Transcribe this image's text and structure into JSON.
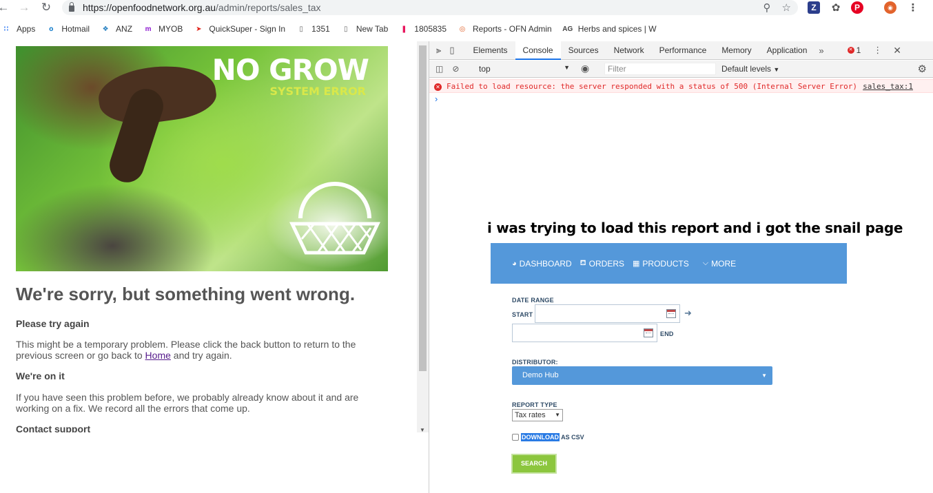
{
  "browser": {
    "url_host": "https://openfoodnetwork.org.au",
    "url_path": "/admin/reports/sales_tax",
    "back_icon": "arrow-left-icon",
    "forward_icon": "arrow-right-icon",
    "reload_icon": "reload-icon"
  },
  "bookmarks": [
    {
      "label": "Apps",
      "icon": "apps-grid-icon",
      "color": "#4285f4"
    },
    {
      "label": "Hotmail",
      "icon": "outlook-icon",
      "color": "#0072c6"
    },
    {
      "label": "ANZ",
      "icon": "anz-icon",
      "color": "#1e7bbf"
    },
    {
      "label": "MYOB",
      "icon": "myob-icon",
      "color": "#8f1cd1"
    },
    {
      "label": "QuickSuper - Sign In",
      "icon": "quicksuper-icon",
      "color": "#e2231a"
    },
    {
      "label": "1351",
      "icon": "page-icon",
      "color": "#666666"
    },
    {
      "label": "New Tab",
      "icon": "page-icon",
      "color": "#666666"
    },
    {
      "label": "1805835",
      "icon": "flag-icon",
      "color": "#e8145c"
    },
    {
      "label": "Reports - OFN Admin",
      "icon": "ofn-icon",
      "color": "#e2632c"
    },
    {
      "label": "Herbs and spices | W",
      "icon": "ag-icon",
      "color": "#444444"
    }
  ],
  "error_page": {
    "hero_title": "NO GROW",
    "hero_subtitle": "SYSTEM ERROR",
    "heading": "We're sorry, but something went wrong.",
    "try_again_title": "Please try again",
    "try_again_text_1": "This might be a temporary problem. Please click the back button to return to the previous screen or go back to ",
    "home_link": "Home",
    "try_again_text_2": " and try again.",
    "on_it_title": "We're on it",
    "on_it_text": "If you have seen this problem before, we probably already know about it and are working on a fix. We record all the errors that come up.",
    "contact_title": "Contact support"
  },
  "devtools": {
    "tabs": [
      "Elements",
      "Console",
      "Sources",
      "Network",
      "Performance",
      "Memory",
      "Application"
    ],
    "active_tab": "Console",
    "error_count": "1",
    "context": "top",
    "filter_placeholder": "Filter",
    "levels": "Default levels",
    "console_error": "Failed to load resource: the server responded with a status of 500 (Internal Server Error)",
    "console_error_source": "sales_tax:1",
    "prompt": "›"
  },
  "annotation": "i was trying to load this report and i got the snail page",
  "report": {
    "nav": [
      {
        "label": "DASHBOARD",
        "icon": "dashboard-icon"
      },
      {
        "label": "ORDERS",
        "icon": "cart-icon"
      },
      {
        "label": "PRODUCTS",
        "icon": "grid-icon"
      },
      {
        "label": "MORE",
        "icon": "chevron-down-icon"
      }
    ],
    "date_range_label": "DATE RANGE",
    "start_label": "START",
    "end_label": "END",
    "start_value": "",
    "end_value": "",
    "distributor_label": "DISTRIBUTOR:",
    "distributor_value": "Demo Hub",
    "report_type_label": "REPORT TYPE",
    "report_type_value": "Tax rates",
    "download_highlight": "DOWNLOAD",
    "download_rest": " AS CSV",
    "download_checked": false,
    "search_button": "SEARCH"
  },
  "colors": {
    "ofn_blue": "#5498da",
    "search_green": "#8cc63e",
    "console_error": "#e02828"
  }
}
